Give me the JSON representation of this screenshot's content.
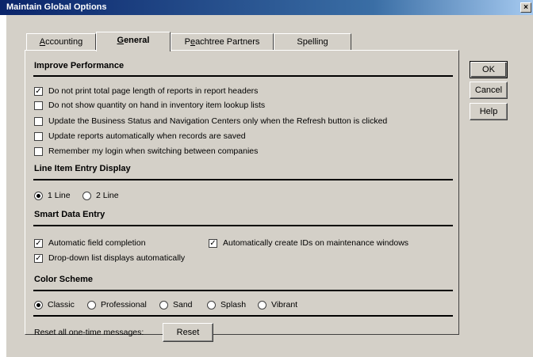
{
  "window": {
    "title": "Maintain Global Options",
    "close_glyph": "×"
  },
  "tabs": [
    {
      "label": "Accounting",
      "accel": "A",
      "rest": "ccounting",
      "active": false
    },
    {
      "label": "General",
      "accel": "G",
      "rest": "eneral",
      "active": true
    },
    {
      "label": "Peachtree Partners",
      "accel_pre": "P",
      "accel": "e",
      "rest": "achtree Partners",
      "active": false
    },
    {
      "label": "Spelling",
      "active": false
    }
  ],
  "sections": {
    "performance": {
      "title": "Improve Performance",
      "options": [
        {
          "label": "Do not print total page length of reports in report headers",
          "checked": true
        },
        {
          "label": "Do not show quantity on hand in inventory item lookup lists",
          "checked": false
        },
        {
          "label": "Update the Business Status and Navigation Centers only when the Refresh button is clicked",
          "checked": false
        },
        {
          "label": "Update reports automatically when records are saved",
          "checked": false
        },
        {
          "label": "Remember my login when switching between companies",
          "checked": false
        }
      ]
    },
    "line_item": {
      "title": "Line Item Entry Display",
      "options": [
        {
          "label": "1 Line",
          "selected": true
        },
        {
          "label": "2 Line",
          "selected": false
        }
      ]
    },
    "smart_data": {
      "title": "Smart Data Entry",
      "options": [
        {
          "label": "Automatic field completion",
          "checked": true
        },
        {
          "label": "Automatically create IDs on maintenance windows",
          "checked": true
        },
        {
          "label": "Drop-down list displays automatically",
          "checked": true
        }
      ]
    },
    "color_scheme": {
      "title": "Color Scheme",
      "options": [
        {
          "label": "Classic",
          "selected": true
        },
        {
          "label": "Professional",
          "selected": false
        },
        {
          "label": "Sand",
          "selected": false
        },
        {
          "label": "Splash",
          "selected": false
        },
        {
          "label": "Vibrant",
          "selected": false
        }
      ]
    }
  },
  "reset": {
    "label": "Reset all one-time messages:",
    "button": "Reset"
  },
  "buttons": {
    "ok": "OK",
    "cancel": "Cancel",
    "help": "Help"
  },
  "colors": {
    "titlebar": "#0a246a",
    "face": "#d4d0c8"
  },
  "check_glyph": "✓"
}
